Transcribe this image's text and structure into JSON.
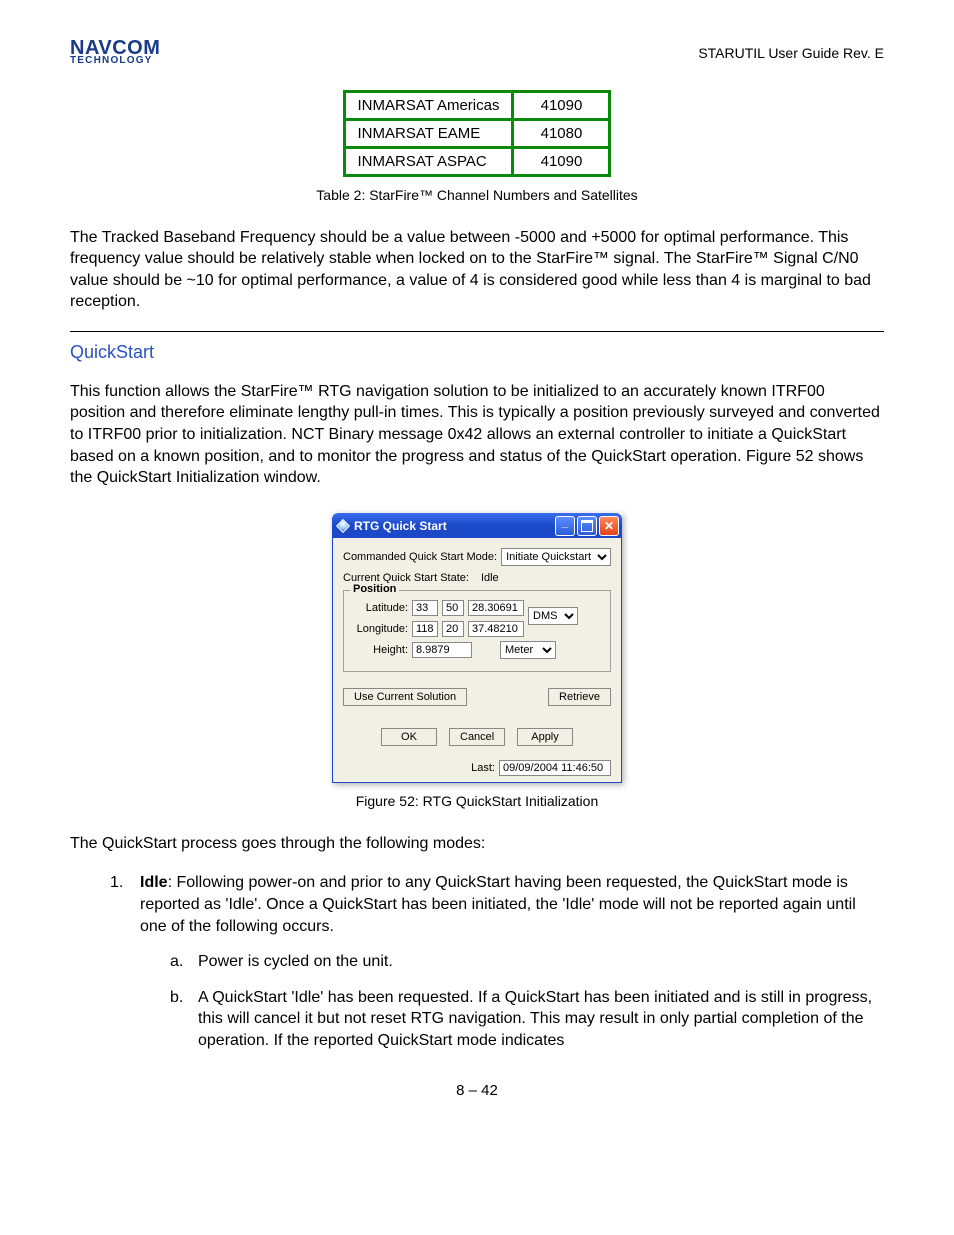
{
  "header": {
    "logo_top": "NAVCOM",
    "logo_bot": "TECHNOLOGY",
    "doc_id": "STARUTIL User Guide Rev. E"
  },
  "sat_table": {
    "rows": [
      {
        "name": "INMARSAT Americas",
        "value": "41090"
      },
      {
        "name": "INMARSAT EAME",
        "value": "41080"
      },
      {
        "name": "INMARSAT ASPAC",
        "value": "41090"
      }
    ],
    "caption": "Table 2: StarFire™ Channel Numbers and Satellites"
  },
  "para1": "The Tracked Baseband Frequency should be a value between -5000 and +5000 for optimal performance. This frequency value should be relatively stable when locked on to the StarFire™ signal. The StarFire™ Signal C/N0 value should be ~10 for optimal performance, a value of 4 is considered good while less than 4 is marginal to bad reception.",
  "quickstart": {
    "title": "QuickStart",
    "para": "This function allows the StarFire™ RTG navigation solution to be initialized to an accurately known ITRF00 position and therefore eliminate lengthy pull-in times. This is typically a position previously surveyed and converted to ITRF00 prior to initialization. NCT Binary message 0x42 allows an external controller to initiate a QuickStart based on a known position, and to monitor the progress and status of the QuickStart operation. Figure 52 shows the QuickStart Initialization window."
  },
  "dialog": {
    "title": "RTG Quick Start",
    "cmd_mode_label": "Commanded Quick Start Mode:",
    "cmd_mode_value": "Initiate Quickstart",
    "state_label": "Current Quick Start State:",
    "state_value": "Idle",
    "position_legend": "Position",
    "lat_label": "Latitude:",
    "lat_deg": "33",
    "lat_min": "50",
    "lat_sec": "28.30691",
    "lon_label": "Longitude:",
    "lon_deg": "118",
    "lon_min": "20",
    "lon_sec": "37.48210",
    "dms_select": "DMS",
    "height_label": "Height:",
    "height_value": "8.9879",
    "height_unit": "Meter",
    "use_current": "Use Current Solution",
    "retrieve": "Retrieve",
    "ok": "OK",
    "cancel": "Cancel",
    "apply": "Apply",
    "last_label": "Last:",
    "last_value": "09/09/2004 11:46:50"
  },
  "fig_caption": "Figure 52: RTG QuickStart Initialization",
  "modes_intro": "The QuickStart process goes through the following modes:",
  "item1": {
    "num": "1.",
    "bold": "Idle",
    "rest": ": Following power-on and prior to any QuickStart having been requested, the QuickStart mode is reported as 'Idle'.   Once a QuickStart has been initiated, the 'Idle' mode will not be reported again until one of the following occurs."
  },
  "sub_a": {
    "letter": "a.",
    "text": "Power is cycled on the unit."
  },
  "sub_b": {
    "letter": "b.",
    "text": "A QuickStart 'Idle' has been requested.  If a QuickStart has been initiated and is still in progress, this will cancel it but not reset RTG navigation.  This may result in only partial completion of the operation.  If the reported QuickStart mode indicates"
  },
  "page_number": "8 – 42"
}
